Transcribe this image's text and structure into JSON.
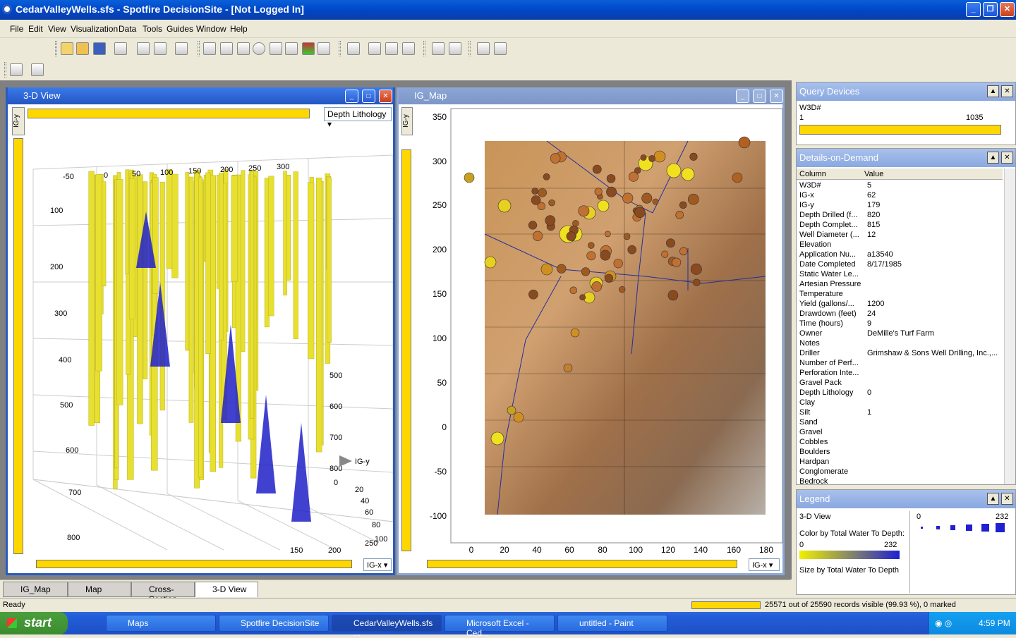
{
  "window": {
    "title": "CedarValleyWells.sfs - Spotfire DecisionSite - [Not Logged In]"
  },
  "menu": [
    "File",
    "Edit",
    "View",
    "Visualization",
    "Data",
    "Tools",
    "Guides",
    "Window",
    "Help"
  ],
  "view3d": {
    "title": "3-D View",
    "color_select": "Depth Lithology",
    "yaxis_label": "IG-y",
    "xaxis_select": "IG-x",
    "top_ticks": [
      "-50",
      "0",
      "50",
      "100",
      "150",
      "200",
      "250",
      "300"
    ],
    "left_ticks": [
      "100",
      "200",
      "300",
      "400",
      "500",
      "600",
      "700",
      "800"
    ],
    "right_ticks": [
      "500",
      "600",
      "700",
      "800"
    ],
    "floor_ticks": [
      "150",
      "200",
      "250"
    ],
    "yfloor_ticks": [
      "0",
      "20",
      "40",
      "60",
      "80",
      "100"
    ],
    "igy_arrow": "IG-y"
  },
  "igmap": {
    "title": "IG_Map",
    "yaxis_label": "IG-y",
    "xaxis_select": "IG-x",
    "yticks": [
      "350",
      "300",
      "250",
      "200",
      "150",
      "100",
      "50",
      "0",
      "-50",
      "-100"
    ],
    "xticks": [
      "0",
      "20",
      "40",
      "60",
      "80",
      "100",
      "120",
      "140",
      "160",
      "180"
    ]
  },
  "query": {
    "title": "Query Devices",
    "field": "W3D#",
    "min": "1",
    "max": "1035"
  },
  "dod": {
    "title": "Details-on-Demand",
    "col_header": "Column",
    "val_header": "Value",
    "rows": [
      [
        "W3D#",
        "5"
      ],
      [
        "IG-x",
        "62"
      ],
      [
        "IG-y",
        "179"
      ],
      [
        "Depth Drilled (f...",
        "820"
      ],
      [
        "Depth Complet...",
        "815"
      ],
      [
        "Well Diameter (...",
        "12"
      ],
      [
        "Elevation",
        ""
      ],
      [
        "Application Nu...",
        "a13540"
      ],
      [
        "Date Completed",
        "8/17/1985"
      ],
      [
        "Static Water Le...",
        ""
      ],
      [
        "Artesian Pressure",
        ""
      ],
      [
        "Temperature",
        ""
      ],
      [
        "Yield (gallons/...",
        "1200"
      ],
      [
        "Drawdown (feet)",
        "24"
      ],
      [
        "Time (hours)",
        "9"
      ],
      [
        "Owner",
        "DeMille's Turf Farm"
      ],
      [
        "Notes",
        ""
      ],
      [
        "Driller",
        "Grimshaw & Sons Well Drilling, Inc.,..."
      ],
      [
        "Number of Perf...",
        ""
      ],
      [
        "Perforation Inte...",
        ""
      ],
      [
        "Gravel Pack",
        ""
      ],
      [
        "Depth Lithology",
        "0"
      ],
      [
        "Clay",
        ""
      ],
      [
        "Silt",
        "1"
      ],
      [
        "Sand",
        ""
      ],
      [
        "Gravel",
        ""
      ],
      [
        "Cobbles",
        ""
      ],
      [
        "Boulders",
        ""
      ],
      [
        "Hardpan",
        ""
      ],
      [
        "Conglomerate",
        ""
      ],
      [
        "Bedrock",
        ""
      ]
    ]
  },
  "legend": {
    "title": "Legend",
    "view": "3-D View",
    "color_by": "Color by Total Water To Depth:",
    "cmin": "0",
    "cmax": "232",
    "size_by": "Size by Total Water To Depth",
    "smin": "0",
    "smax": "232"
  },
  "tabs": [
    "IG_Map",
    "Map",
    "Cross-Section",
    "3-D View"
  ],
  "status": {
    "left": "Ready",
    "right": "25571 out of 25590 records visible (99.93 %), 0 marked"
  },
  "taskbar": {
    "start": "start",
    "items": [
      "Maps",
      "Spotfire DecisionSite",
      "CedarValleyWells.sfs ...",
      "Microsoft Excel - Ced...",
      "untitled - Paint"
    ],
    "clock": "4:59 PM"
  },
  "colors": {
    "accent": "#2a5cc0",
    "slider": "#ffd700",
    "well_yellow": "#e8e030",
    "well_blue": "#2020c8"
  }
}
